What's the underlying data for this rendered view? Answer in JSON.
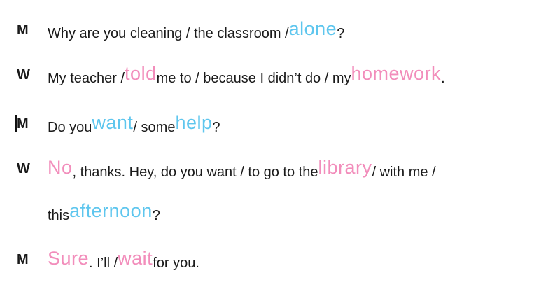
{
  "colors": {
    "blue": "#5ec6ee",
    "pink": "#f28dbb",
    "text": "#1a1a1a"
  },
  "lines": [
    {
      "speaker": "M",
      "segments": [
        {
          "text": "Why are you cleaning / the classroom / ",
          "style": "plain"
        },
        {
          "text": "alone",
          "style": "blue"
        },
        {
          "text": "?",
          "style": "plain"
        }
      ]
    },
    {
      "speaker": "W",
      "segments": [
        {
          "text": "My teacher / ",
          "style": "plain"
        },
        {
          "text": "told",
          "style": "pink"
        },
        {
          "text": " me to / because I didn’t do / my ",
          "style": "plain"
        },
        {
          "text": "homework",
          "style": "pink"
        },
        {
          "text": ".",
          "style": "plain"
        }
      ]
    },
    {
      "speaker": "M",
      "segments": [
        {
          "text": "Do you ",
          "style": "plain"
        },
        {
          "text": "want",
          "style": "blue"
        },
        {
          "text": " / some ",
          "style": "plain"
        },
        {
          "text": "help",
          "style": "blue"
        },
        {
          "text": "?",
          "style": "plain"
        }
      ]
    },
    {
      "speaker": "W",
      "segments": [
        {
          "text": "No",
          "style": "pink"
        },
        {
          "text": ", thanks. Hey, do you want / to go to the ",
          "style": "plain"
        },
        {
          "text": "library",
          "style": "pink"
        },
        {
          "text": " / with me /",
          "style": "plain"
        }
      ]
    },
    {
      "speaker": "",
      "segments": [
        {
          "text": "this ",
          "style": "plain"
        },
        {
          "text": "afternoon",
          "style": "blue"
        },
        {
          "text": "?",
          "style": "plain"
        }
      ]
    },
    {
      "speaker": "M",
      "segments": [
        {
          "text": "Sure",
          "style": "pink"
        },
        {
          "text": ". I’ll / ",
          "style": "plain"
        },
        {
          "text": "wait",
          "style": "pink"
        },
        {
          "text": " for you.",
          "style": "plain"
        }
      ]
    }
  ]
}
